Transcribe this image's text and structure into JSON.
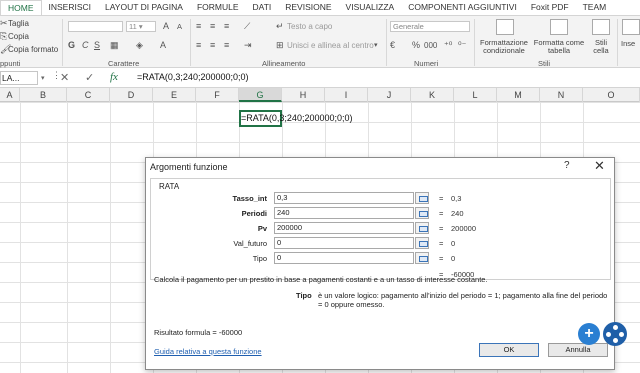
{
  "ribbon_tabs": [
    "HOME",
    "INSERISCI",
    "LAYOUT DI PAGINA",
    "FORMULE",
    "DATI",
    "REVISIONE",
    "VISUALIZZA",
    "COMPONENTI AGGIUNTIVI",
    "Foxit PDF",
    "TEAM"
  ],
  "ribbon": {
    "clipboard": {
      "cut": "Taglia",
      "copy": "Copia",
      "format_painter": "Copia formato",
      "group": "ppunti"
    },
    "font": {
      "size": "11",
      "grow": "A",
      "shrink": "A",
      "bold": "G",
      "italic": "C",
      "underline": "S",
      "group": "Carattere"
    },
    "alignment": {
      "wrap": "Testo a capo",
      "merge": "Unisci e allinea al centro",
      "group": "Allineamento"
    },
    "number": {
      "format": "Generale",
      "percent": "%",
      "thousands": "000",
      "group": "Numeri"
    },
    "styles": {
      "conditional": "Formattazione condizionale",
      "table": "Formatta come tabella",
      "cell": "Stili cella",
      "group": "Stili"
    },
    "insert": "Inse"
  },
  "formula_bar": {
    "name_box": "LA...",
    "fx": "fx",
    "formula": "=RATA(0,3;240;200000;0;0)"
  },
  "columns": [
    "A",
    "B",
    "C",
    "D",
    "E",
    "F",
    "G",
    "H",
    "I",
    "J",
    "K",
    "L",
    "M",
    "N",
    "O"
  ],
  "selected_column": "G",
  "cell_content": "=RATA(0,3;240;200000;0;0)",
  "dialog": {
    "title": "Argomenti funzione",
    "help": "?",
    "close": "✕",
    "function_name": "RATA",
    "arguments": [
      {
        "label": "Tasso_int",
        "bold": true,
        "value": "0,3",
        "result": "0,3"
      },
      {
        "label": "Periodi",
        "bold": true,
        "value": "240",
        "result": "240"
      },
      {
        "label": "Pv",
        "bold": true,
        "value": "200000",
        "result": "200000"
      },
      {
        "label": "Val_futuro",
        "bold": false,
        "value": "0",
        "result": "0"
      },
      {
        "label": "Tipo",
        "bold": false,
        "value": "0",
        "result": "0"
      }
    ],
    "equals": "=",
    "total_result": "-60000",
    "description": "Calcola il pagamento per un prestito in base a pagamenti costanti e a un tasso di interesse costante.",
    "arg_desc_label": "Tipo",
    "arg_desc": "è un valore logico: pagamento all'inizio del periodo = 1; pagamento alla fine del periodo = 0 oppure omesso.",
    "result_formula": "Risultato formula =    -60000",
    "help_link": "Guida relativa a questa funzione",
    "ok": "OK",
    "cancel": "Annulla"
  }
}
